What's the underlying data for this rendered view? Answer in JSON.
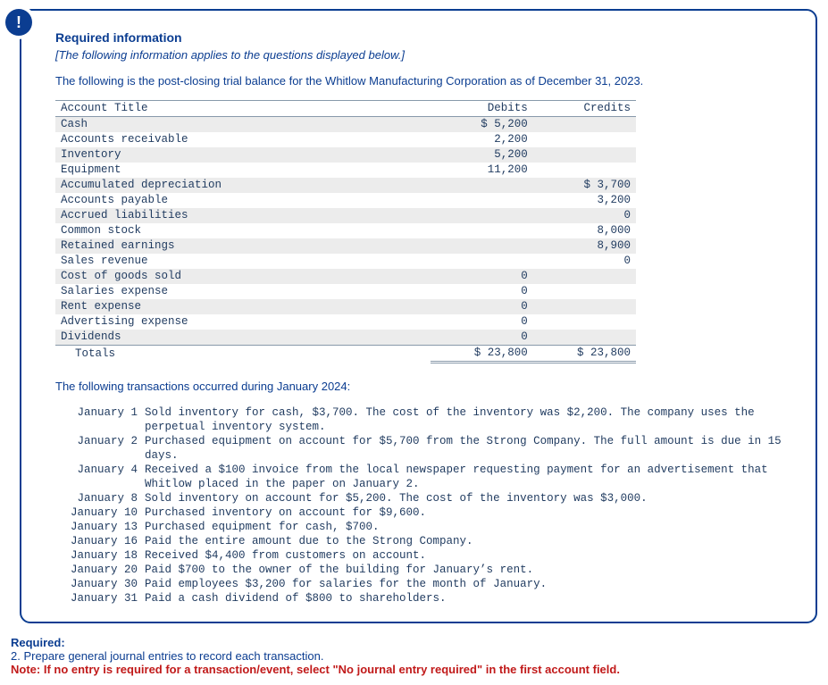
{
  "badge": "!",
  "heading": "Required information",
  "italic": "[The following information applies to the questions displayed below.]",
  "intro": "The following is the post-closing trial balance for the Whitlow Manufacturing Corporation as of December 31, 2023.",
  "table": {
    "h_acct": "Account Title",
    "h_deb": "Debits",
    "h_cre": "Credits",
    "rows": [
      {
        "a": "Cash",
        "d": "$ 5,200",
        "c": ""
      },
      {
        "a": "Accounts receivable",
        "d": "2,200",
        "c": ""
      },
      {
        "a": "Inventory",
        "d": "5,200",
        "c": ""
      },
      {
        "a": "Equipment",
        "d": "11,200",
        "c": ""
      },
      {
        "a": "Accumulated depreciation",
        "d": "",
        "c": "$ 3,700"
      },
      {
        "a": "Accounts payable",
        "d": "",
        "c": "3,200"
      },
      {
        "a": "Accrued liabilities",
        "d": "",
        "c": "0"
      },
      {
        "a": "Common stock",
        "d": "",
        "c": "8,000"
      },
      {
        "a": "Retained earnings",
        "d": "",
        "c": "8,900"
      },
      {
        "a": "Sales revenue",
        "d": "",
        "c": "0"
      },
      {
        "a": "Cost of goods sold",
        "d": "0",
        "c": ""
      },
      {
        "a": "Salaries expense",
        "d": "0",
        "c": ""
      },
      {
        "a": "Rent expense",
        "d": "0",
        "c": ""
      },
      {
        "a": "Advertising expense",
        "d": "0",
        "c": ""
      },
      {
        "a": "Dividends",
        "d": "0",
        "c": ""
      }
    ],
    "tot_lbl": "Totals",
    "tot_d": "$ 23,800",
    "tot_c": "$ 23,800"
  },
  "trx_intro": "The following transactions occurred during January 2024:",
  "trx": [
    {
      "date": "January 1",
      "txt": "Sold inventory for cash, $3,700. The cost of the inventory was $2,200. The company uses the perpetual inventory system."
    },
    {
      "date": "January 2",
      "txt": "Purchased equipment on account for $5,700 from the Strong Company. The full amount is due in 15 days."
    },
    {
      "date": "January 4",
      "txt": "Received a $100 invoice from the local newspaper requesting payment for an advertisement that Whitlow placed in the paper on January 2."
    },
    {
      "date": "January 8",
      "txt": "Sold inventory on account for $5,200. The cost of the inventory was $3,000."
    },
    {
      "date": "January 10",
      "txt": "Purchased inventory on account for $9,600."
    },
    {
      "date": "January 13",
      "txt": "Purchased equipment for cash, $700."
    },
    {
      "date": "January 16",
      "txt": "Paid the entire amount due to the Strong Company."
    },
    {
      "date": "January 18",
      "txt": "Received $4,400 from customers on account."
    },
    {
      "date": "January 20",
      "txt": "Paid $700 to the owner of the building for January’s rent."
    },
    {
      "date": "January 30",
      "txt": "Paid employees $3,200 for salaries for the month of January."
    },
    {
      "date": "January 31",
      "txt": "Paid a cash dividend of $800 to shareholders."
    }
  ],
  "req": {
    "label": "Required:",
    "line": "2. Prepare general journal entries to record each transaction.",
    "note": "Note: If no entry is required for a transaction/event, select \"No journal entry required\" in the first account field."
  }
}
